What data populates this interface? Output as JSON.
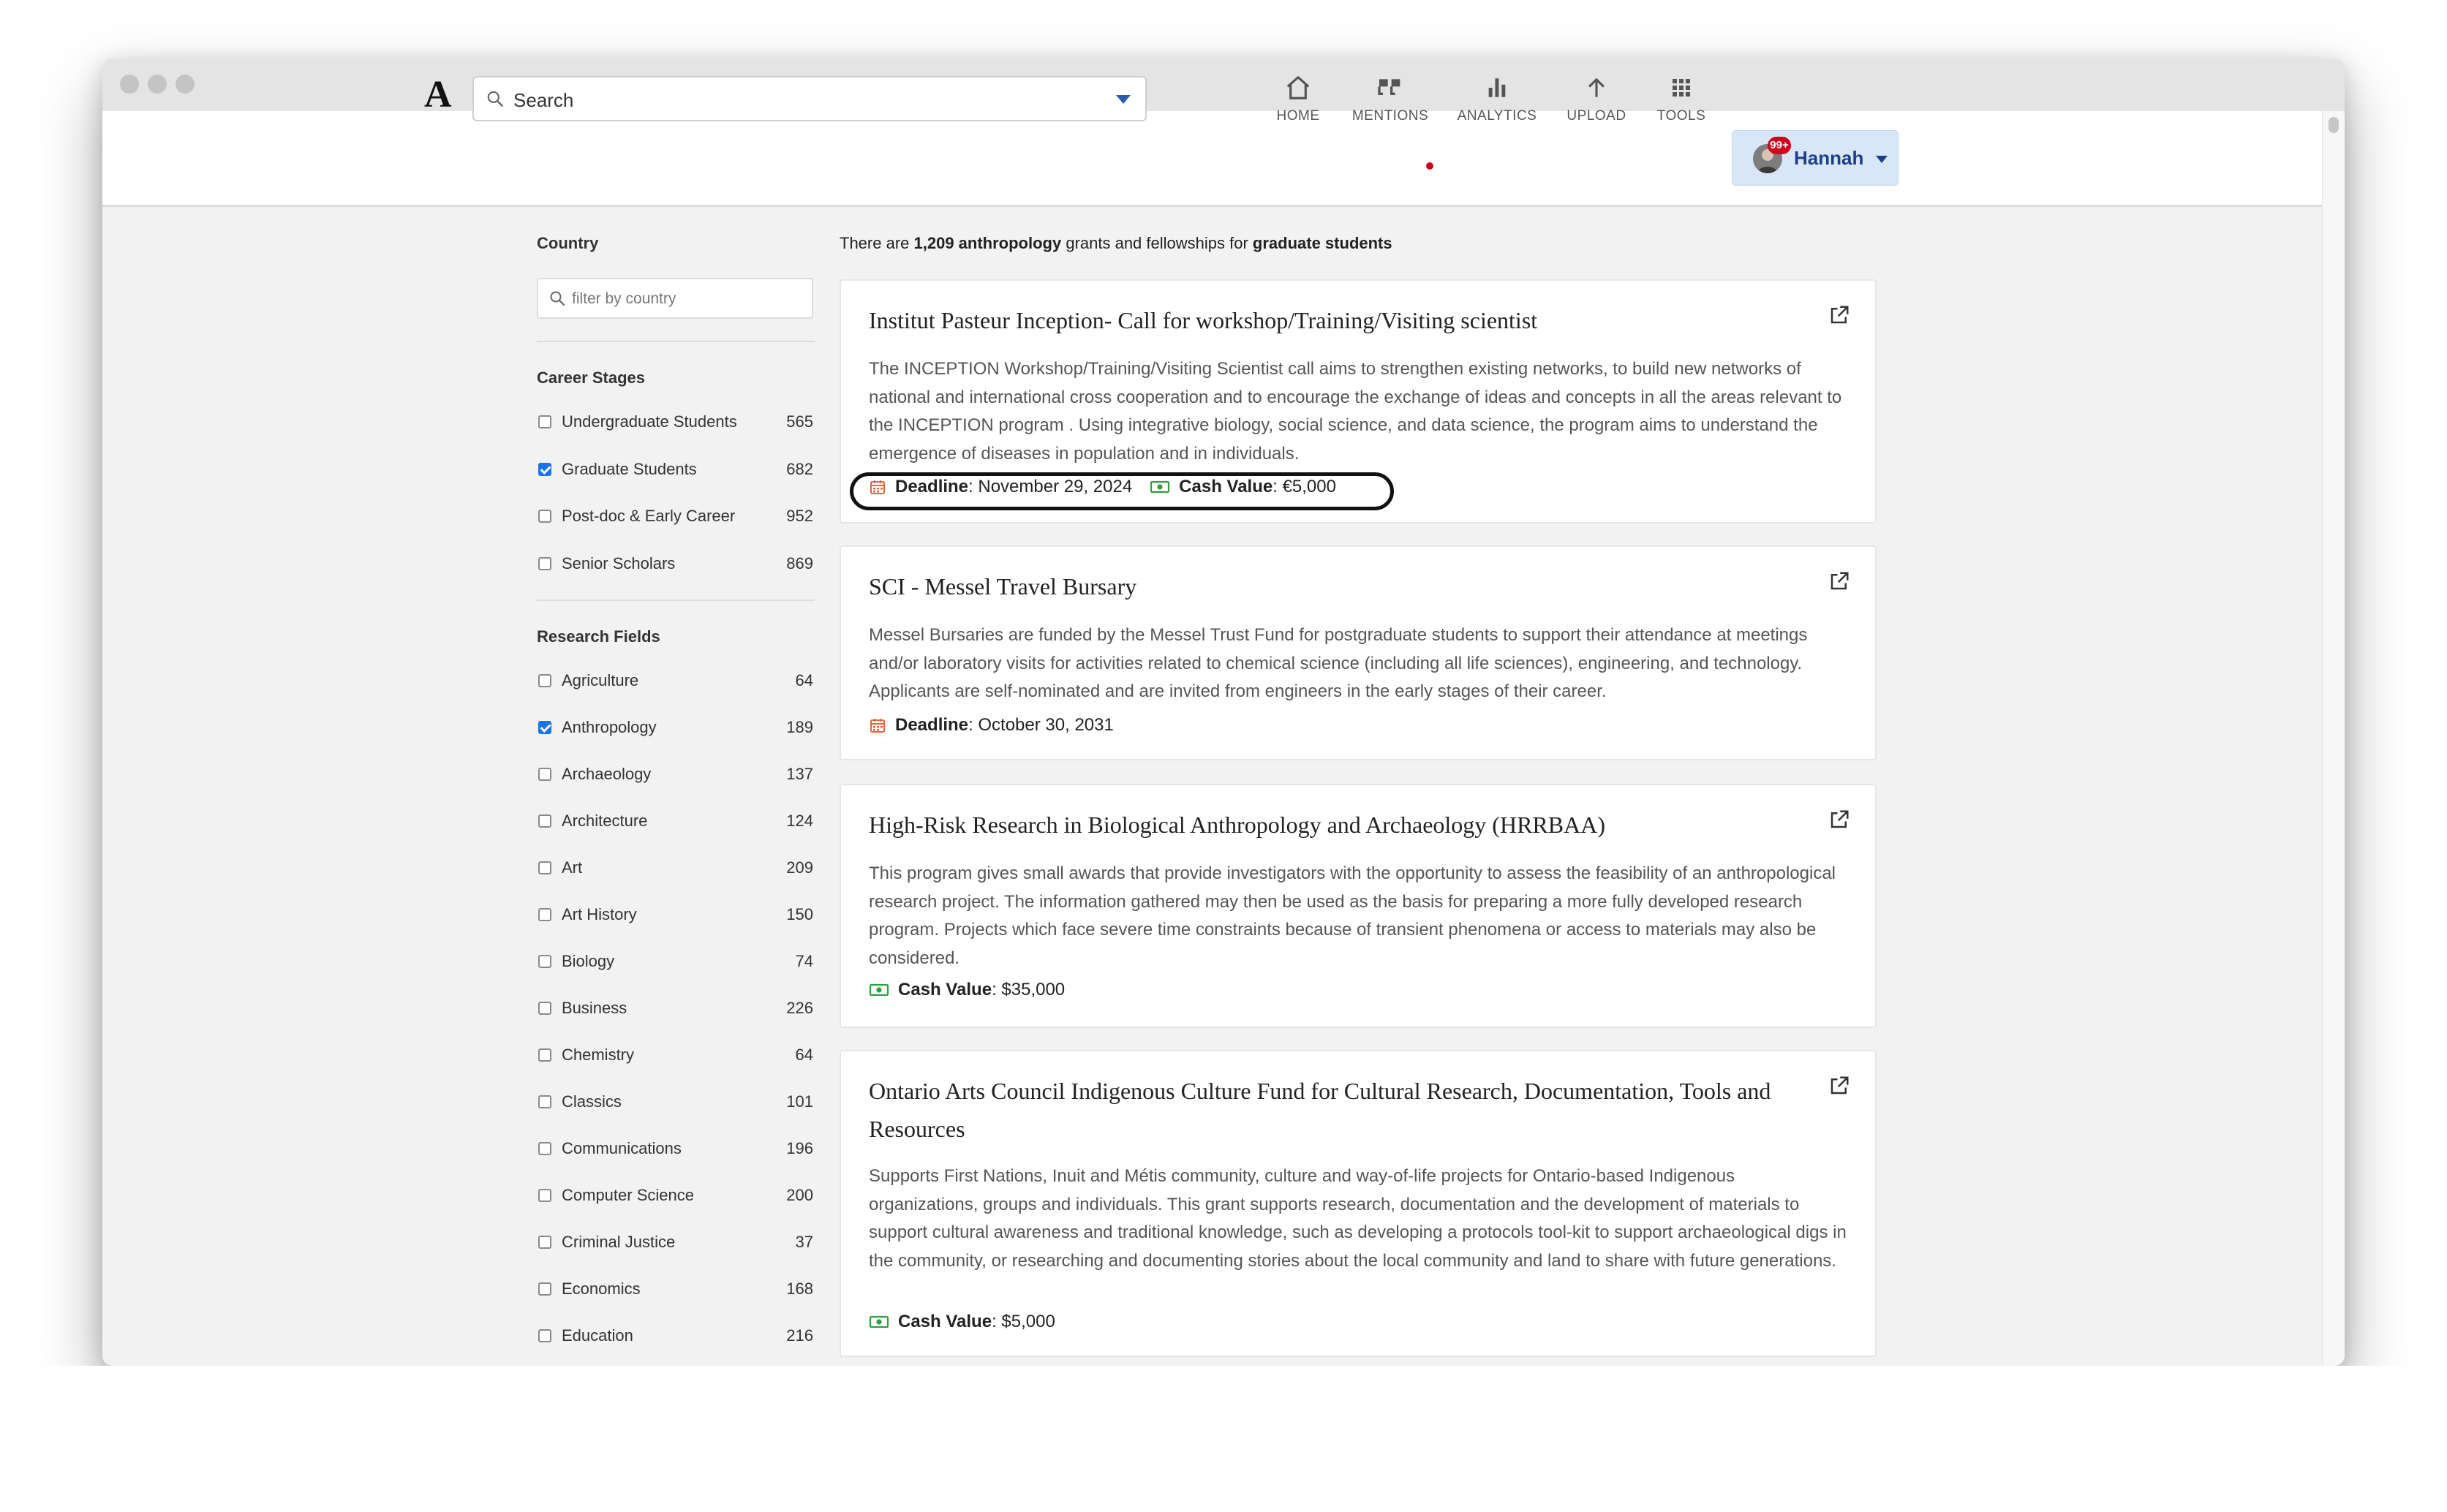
{
  "app": {
    "logo": "A"
  },
  "search": {
    "placeholder": "Search"
  },
  "nav": {
    "home": "HOME",
    "mentions": "MENTIONS",
    "analytics": "ANALYTICS",
    "upload": "UPLOAD",
    "tools": "TOOLS"
  },
  "user": {
    "name": "Hannah",
    "badge": "99+"
  },
  "sidebar": {
    "country_heading": "Country",
    "country_placeholder": "filter by country",
    "career_heading": "Career Stages",
    "career_stages": [
      {
        "label": "Undergraduate Students",
        "count": "565",
        "checked": false
      },
      {
        "label": "Graduate Students",
        "count": "682",
        "checked": true
      },
      {
        "label": "Post-doc & Early Career",
        "count": "952",
        "checked": false
      },
      {
        "label": "Senior Scholars",
        "count": "869",
        "checked": false
      }
    ],
    "fields_heading": "Research Fields",
    "research_fields": [
      {
        "label": "Agriculture",
        "count": "64",
        "checked": false
      },
      {
        "label": "Anthropology",
        "count": "189",
        "checked": true
      },
      {
        "label": "Archaeology",
        "count": "137",
        "checked": false
      },
      {
        "label": "Architecture",
        "count": "124",
        "checked": false
      },
      {
        "label": "Art",
        "count": "209",
        "checked": false
      },
      {
        "label": "Art History",
        "count": "150",
        "checked": false
      },
      {
        "label": "Biology",
        "count": "74",
        "checked": false
      },
      {
        "label": "Business",
        "count": "226",
        "checked": false
      },
      {
        "label": "Chemistry",
        "count": "64",
        "checked": false
      },
      {
        "label": "Classics",
        "count": "101",
        "checked": false
      },
      {
        "label": "Communications",
        "count": "196",
        "checked": false
      },
      {
        "label": "Computer Science",
        "count": "200",
        "checked": false
      },
      {
        "label": "Criminal Justice",
        "count": "37",
        "checked": false
      },
      {
        "label": "Economics",
        "count": "168",
        "checked": false
      },
      {
        "label": "Education",
        "count": "216",
        "checked": false
      }
    ]
  },
  "results": {
    "summary_prefix": "There are ",
    "summary_count": "1,209 anthropology",
    "summary_middle": " grants and fellowships for ",
    "summary_audience": "graduate students",
    "items": [
      {
        "title": "Institut Pasteur Inception- Call for workshop/Training/Visiting scientist",
        "description": "The INCEPTION Workshop/Training/Visiting Scientist call aims to strengthen existing networks, to build new networks of national and international cross cooperation and to encourage the exchange of ideas and concepts in all the areas relevant to the INCEPTION program . Using integrative biology, social science, and data science, the program aims to understand the emergence of diseases in population and in individuals.",
        "deadline_label": "Deadline",
        "deadline": ": November 29, 2024",
        "cash_label": "Cash Value",
        "cash": ": €5,000"
      },
      {
        "title": "SCI - Messel Travel Bursary",
        "description": "Messel Bursaries are funded by the Messel Trust Fund for postgraduate students to support their attendance at meetings and/or laboratory visits for activities related to chemical science (including all life sciences), engineering, and technology. Applicants are self-nominated and are invited from engineers in the early stages of their career.",
        "deadline_label": "Deadline",
        "deadline": ": October 30, 2031"
      },
      {
        "title": "High-Risk Research in Biological Anthropology and Archaeology (HRRBAA)",
        "description": "This program gives small awards that provide investigators with the opportunity to assess the feasibility of an anthropological research project. The information gathered may then be used as the basis for preparing a more fully developed research program. Projects which face severe time constraints because of transient phenomena or access to materials may also be considered.",
        "cash_label": "Cash Value",
        "cash": ": $35,000"
      },
      {
        "title": "Ontario Arts Council Indigenous Culture Fund for Cultural Research, Documentation, Tools and Resources",
        "description": "Supports First Nations, Inuit and Métis community, culture and way-of-life projects for Ontario-based Indigenous organizations, groups and individuals. This grant supports research, documentation and the development of materials to support cultural awareness and traditional knowledge, such as developing a protocols tool-kit to support archaeological digs in the community, or researching and documenting stories about the local community and land to share with future generations.",
        "cash_label": "Cash Value",
        "cash": ": $5,000"
      }
    ]
  },
  "colors": {
    "accent": "#1a73e8",
    "deadline_icon": "#e8643a",
    "cash_icon": "#2e9e3e",
    "notification": "#d0021b"
  }
}
